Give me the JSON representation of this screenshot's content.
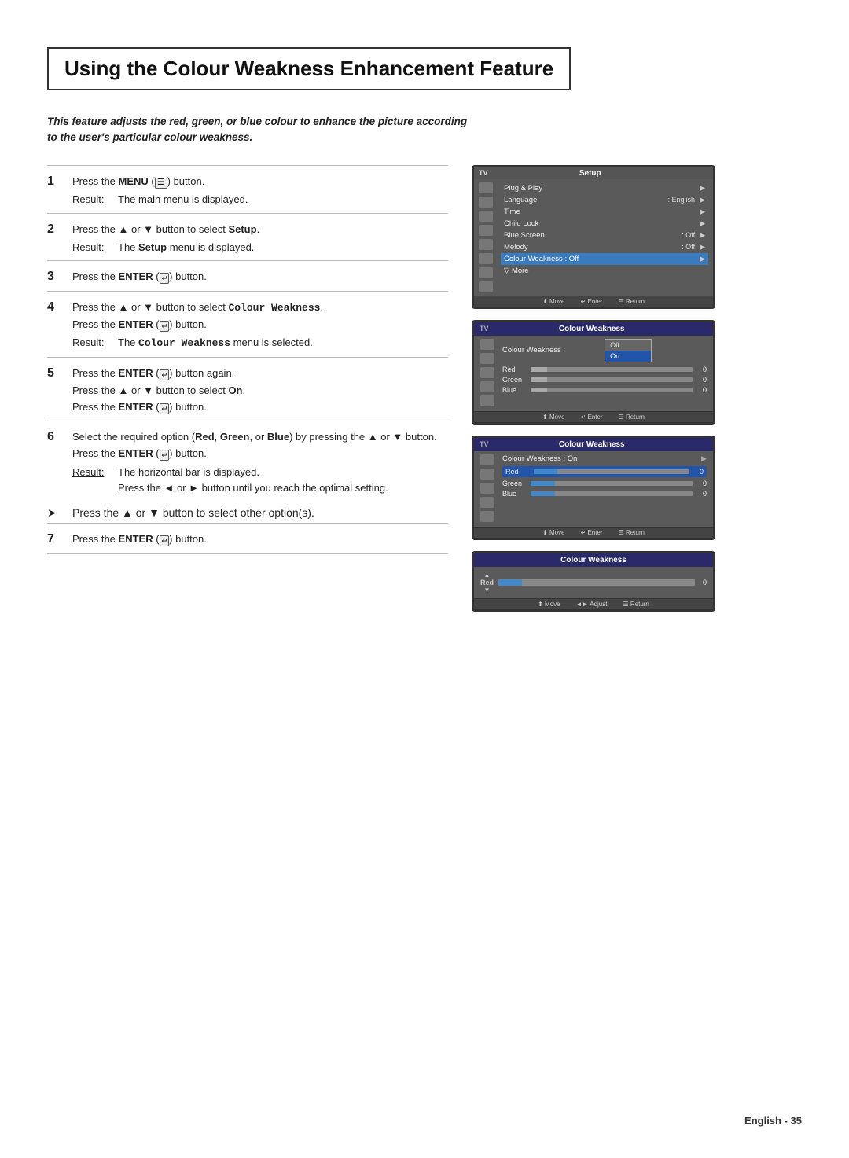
{
  "page": {
    "background": "#ffffff"
  },
  "title": "Using the Colour Weakness Enhancement Feature",
  "intro": "This feature adjusts the red, green, or blue colour to enhance the picture according to the user's particular colour weakness.",
  "steps": [
    {
      "num": "1",
      "text_before": "Press the ",
      "bold1": "MENU",
      "text_mid": " (",
      "symbol": "☰",
      "text_after": ") button.",
      "result_label": "Result:",
      "result_text": "The main menu is displayed."
    },
    {
      "num": "2",
      "text_before": "Press the ▲ or ▼ button to select ",
      "bold1": "Setup",
      "text_after": ".",
      "result_label": "Result:",
      "result_text": "The ",
      "result_bold": "Setup",
      "result_text2": " menu is displayed."
    },
    {
      "num": "3",
      "text_before": "Press the ",
      "bold1": "ENTER",
      "text_mid": " (",
      "symbol": "↵",
      "text_after": ") button."
    },
    {
      "num": "4",
      "line1_before": "Press the ▲ or ▼ button to select ",
      "line1_bold": "Colour Weakness",
      "line1_after": ".",
      "line2_before": "Press the ",
      "line2_bold": "ENTER",
      "line2_after": " (↵) button.",
      "result_label": "Result:",
      "result_text": "The ",
      "result_bold": "Colour Weakness",
      "result_text2": " menu is selected."
    },
    {
      "num": "5",
      "line1_before": "Press the ",
      "line1_bold": "ENTER",
      "line1_after": " (↵) button again.",
      "line2": "Press the ▲ or ▼ button to select ",
      "line2_bold": "On",
      "line2_after": ".",
      "line3_before": "Press the ",
      "line3_bold": "ENTER",
      "line3_after": " (↵) button."
    },
    {
      "num": "6",
      "line1_before": "Select the required option (",
      "line1_bold1": "Red",
      "line1_sep1": ", ",
      "line1_bold2": "Green",
      "line1_sep2": ", or ",
      "line1_bold3": "Blue",
      "line1_after": ") by pressing the",
      "line2": "▲ or ▼ button. Press the ",
      "line2_bold": "ENTER",
      "line2_after": " (↵) button.",
      "result_label": "Result:",
      "result_text": "The horizontal bar is displayed.",
      "result_text2": "Press the ◄ or ► button until you reach the optimal",
      "result_text3": "setting.",
      "note_arrow": "➤",
      "note_text": "Press the ▲ or ▼ button to select other option(s)."
    },
    {
      "num": "7",
      "text_before": "Press the ",
      "bold1": "ENTER",
      "text_after": " (↵) button."
    }
  ],
  "screens": {
    "screen1": {
      "tv_label": "TV",
      "title": "Setup",
      "rows": [
        {
          "icon": "cam",
          "label": "Plug & Play",
          "value": "",
          "arrow": "▶"
        },
        {
          "icon": "speaker",
          "label": "Language",
          "value": ": English",
          "arrow": "▶"
        },
        {
          "icon": "clock",
          "label": "Time",
          "value": "",
          "arrow": "▶"
        },
        {
          "icon": "lock",
          "label": "Child Lock",
          "value": "",
          "arrow": "▶"
        },
        {
          "icon": "screen",
          "label": "Blue Screen",
          "value": ": Off",
          "arrow": "▶"
        },
        {
          "icon": "music",
          "label": "Melody",
          "value": ": Off",
          "arrow": "▶"
        },
        {
          "icon": "color",
          "label": "Colour Weakness",
          "value": ": Off",
          "arrow": "▶",
          "highlighted": true
        },
        {
          "icon": "more",
          "label": "▽ More",
          "value": "",
          "arrow": ""
        }
      ],
      "bottom": [
        "⬆ Move",
        "↵ Enter",
        "☰ Return"
      ]
    },
    "screen2": {
      "tv_label": "TV",
      "title": "Colour Weakness",
      "header_label": "Colour Weakness :",
      "options": [
        "Off",
        "On"
      ],
      "active_option": "On",
      "rows": [
        {
          "label": "Red",
          "value": 0
        },
        {
          "label": "Green",
          "value": 0
        },
        {
          "label": "Blue",
          "value": 0
        }
      ],
      "bottom": [
        "⬆ Move",
        "↵ Enter",
        "☰ Return"
      ]
    },
    "screen3": {
      "tv_label": "TV",
      "title": "Colour Weakness",
      "header_label": "Colour Weakness : On",
      "rows": [
        {
          "label": "Red",
          "value": 0
        },
        {
          "label": "Green",
          "value": 0
        },
        {
          "label": "Blue",
          "value": 0
        }
      ],
      "bottom": [
        "⬆ Move",
        "↵ Enter",
        "☰ Return"
      ]
    },
    "screen4": {
      "title": "Colour Weakness",
      "label": "Red",
      "value": 0,
      "bottom": [
        "⬆ Move",
        "◄► Adjust",
        "☰ Return"
      ]
    }
  },
  "footer": {
    "text": "English - 35"
  }
}
